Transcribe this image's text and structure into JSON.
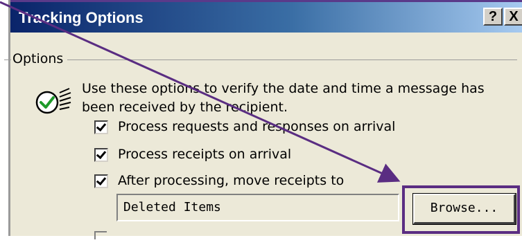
{
  "window": {
    "title": "Tracking Options",
    "help_label": "?",
    "close_label": "X"
  },
  "options_group": {
    "label": "Options",
    "description": "Use these options to verify the date and time a message has been received by the recipient.",
    "icon": "tracking-check-icon",
    "checkboxes": [
      {
        "label": "Process requests and responses on arrival",
        "checked": true
      },
      {
        "label": "Process receipts on arrival",
        "checked": true
      },
      {
        "label": "After processing, move receipts to",
        "checked": true
      }
    ],
    "folder_value": "Deleted Items",
    "browse_label": "Browse..."
  },
  "annotation": {
    "arrow_color": "#5a2d82",
    "highlight_color": "#5a2d82"
  }
}
